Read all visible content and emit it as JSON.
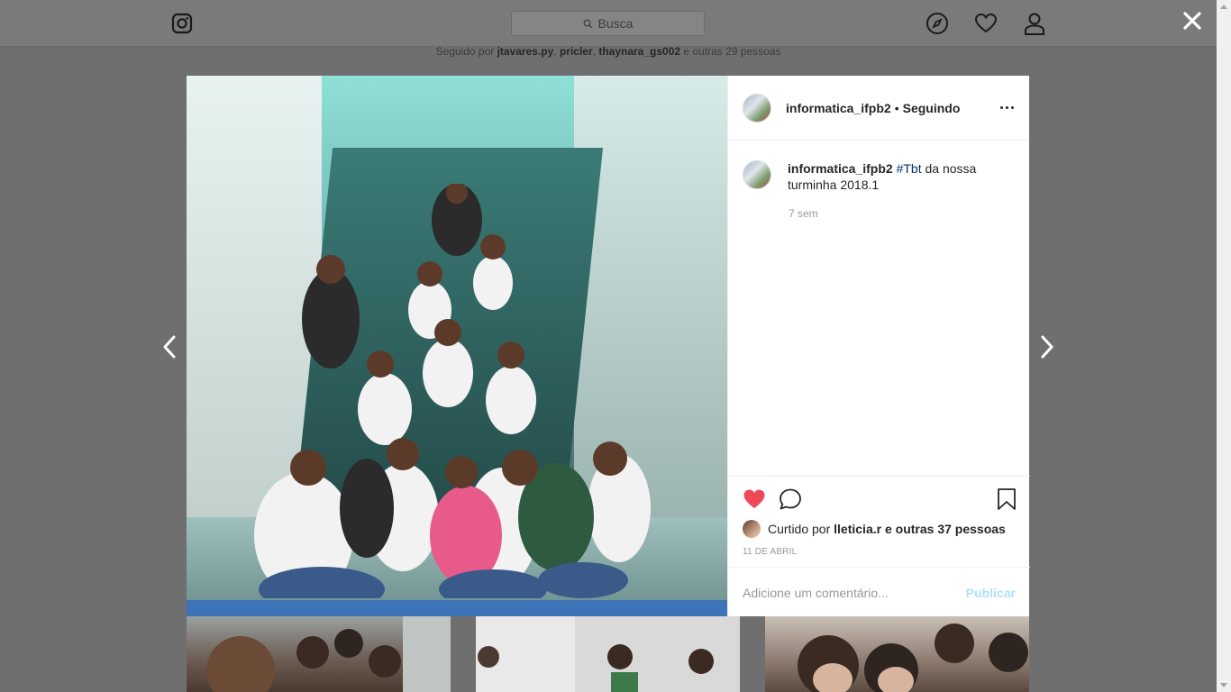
{
  "search": {
    "placeholder": "Busca"
  },
  "followed_by": {
    "prefix": "Seguido por",
    "users": [
      "jtavares.py",
      "pricler",
      "thaynara_gs002"
    ],
    "suffix": "e outras 29 pessoas"
  },
  "post": {
    "username": "informatica_ifpb2",
    "separator": "•",
    "following_label": "Seguindo",
    "caption": {
      "username": "informatica_ifpb2",
      "hashtag": "#Tbt",
      "text": "da nossa turminha 2018.1"
    },
    "time_ago": "7 sem",
    "liked_by": {
      "prefix": "Curtido por",
      "user": "lleticia.r",
      "suffix": "e outras 37 pessoas"
    },
    "date": "11 DE ABRIL",
    "comment_placeholder": "Adicione um comentário...",
    "publish_label": "Publicar"
  },
  "colors": {
    "like": "#ed4956",
    "hashtag": "#003569",
    "publish_disabled": "#b2dffc"
  }
}
